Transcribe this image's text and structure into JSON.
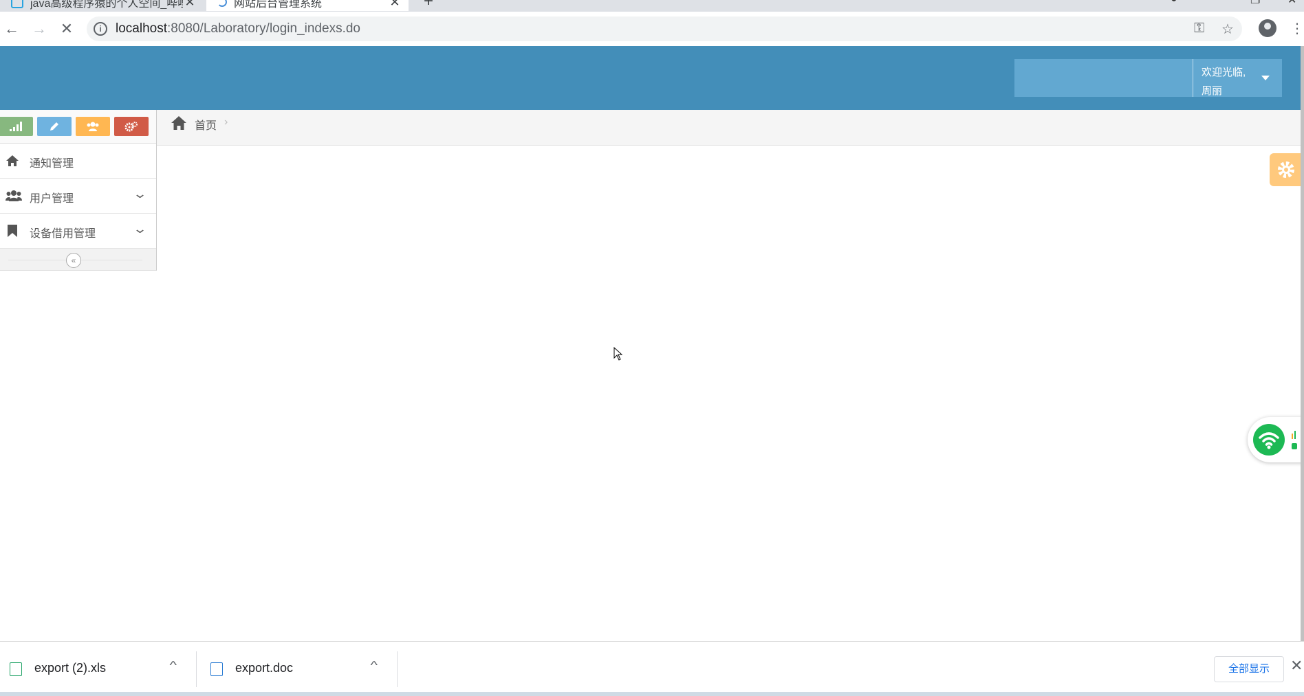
{
  "browser": {
    "tabs": [
      {
        "title": "java高级程序猿的个人空间_哔哩",
        "active": false
      },
      {
        "title": "网站后台管理系统",
        "active": true
      }
    ],
    "url": "localhost:8080/Laboratory/login_indexs.do",
    "url_host": "localhost",
    "url_rest": ":8080/Laboratory/login_indexs.do"
  },
  "header": {
    "welcome": "欢迎光临,",
    "username": "周丽",
    "bg_color": "#438eb9"
  },
  "sidebar": {
    "shortcuts": [
      {
        "icon": "signal-icon",
        "color": "#87b87f"
      },
      {
        "icon": "pencil-icon",
        "color": "#6fb3e0"
      },
      {
        "icon": "users-icon",
        "color": "#ffb752"
      },
      {
        "icon": "cogs-icon",
        "color": "#d15b47"
      }
    ],
    "items": [
      {
        "label": "通知管理",
        "icon": "home-icon",
        "expandable": false
      },
      {
        "label": "用户管理",
        "icon": "users-icon",
        "expandable": true
      },
      {
        "label": "设备借用管理",
        "icon": "bookmark-icon",
        "expandable": true
      }
    ]
  },
  "breadcrumb": {
    "home_label": "首页"
  },
  "downloads": {
    "items": [
      {
        "name": "export (2).xls",
        "type": "xls"
      },
      {
        "name": "export.doc",
        "type": "doc"
      }
    ],
    "show_all": "全部显示"
  }
}
